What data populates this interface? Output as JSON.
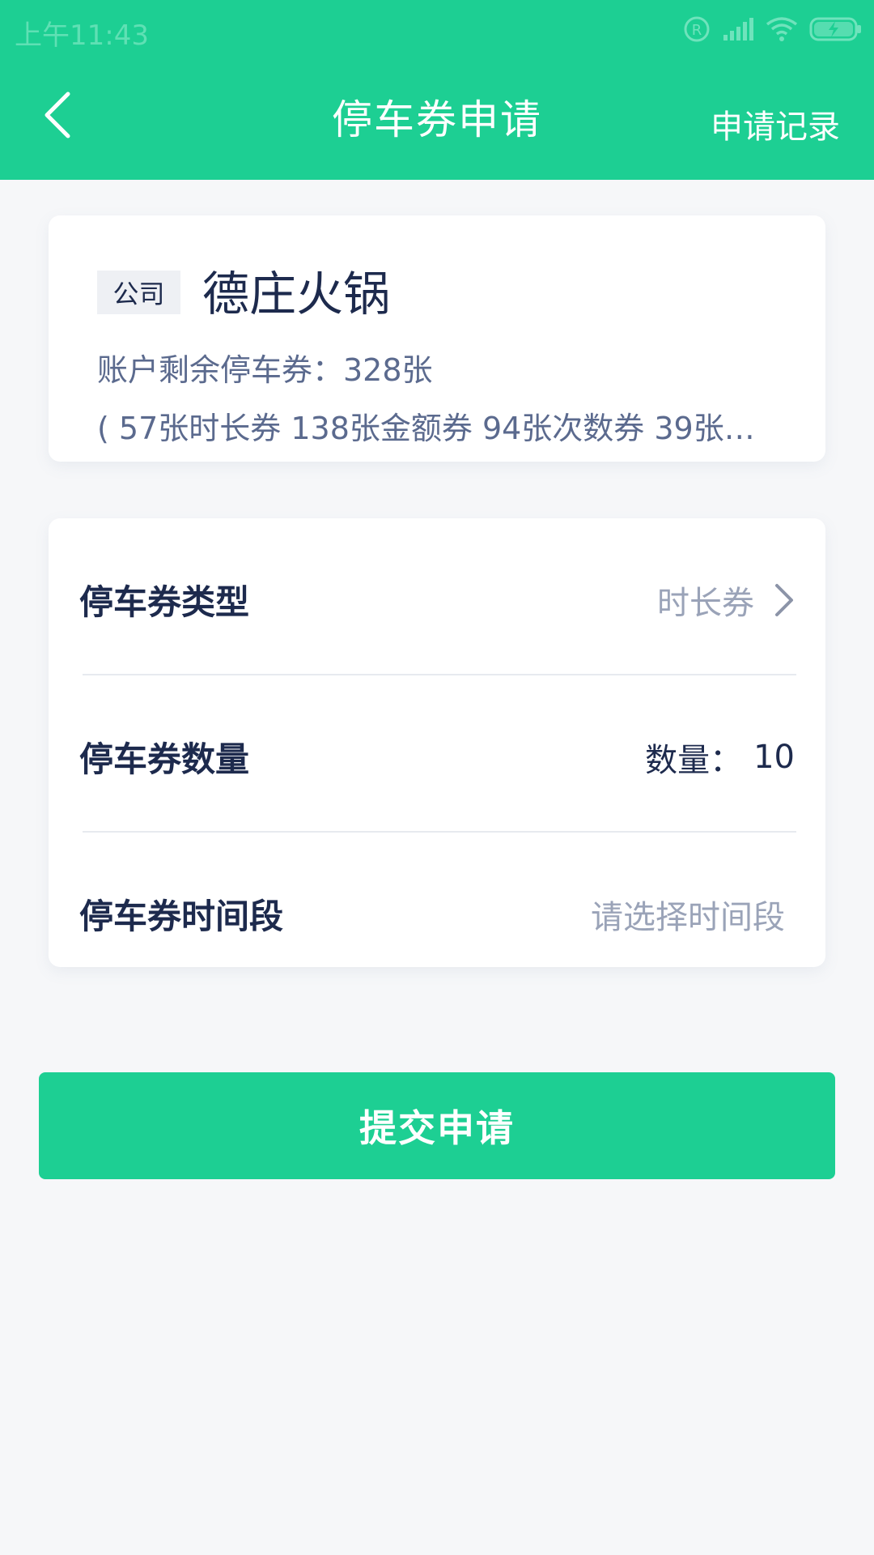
{
  "status_bar": {
    "time": "上午11:43",
    "icons": [
      "registered-icon",
      "signal-icon",
      "wifi-icon",
      "battery-charging-icon"
    ]
  },
  "nav": {
    "title": "停车券申请",
    "action": "申请记录",
    "back_icon": "chevron-left-icon"
  },
  "company_card": {
    "tag": "公司",
    "name": "德庄火锅",
    "remaining": "账户剩余停车券：328张",
    "breakdown": "( 57张时长券 138张金额券 94张次数券 39张…"
  },
  "form": {
    "type": {
      "label": "停车券类型",
      "value": "时长券"
    },
    "quantity": {
      "label": "停车券数量",
      "prefix": "数量：",
      "value": "10"
    },
    "period": {
      "label": "停车券时间段",
      "placeholder": "请选择时间段"
    }
  },
  "submit_label": "提交申请",
  "colors": {
    "brand": "#1dcf93",
    "text_dark": "#1d2a4d",
    "text_mid": "#5b6a8e",
    "text_light": "#9aa3b8",
    "background": "#f6f7f9"
  }
}
